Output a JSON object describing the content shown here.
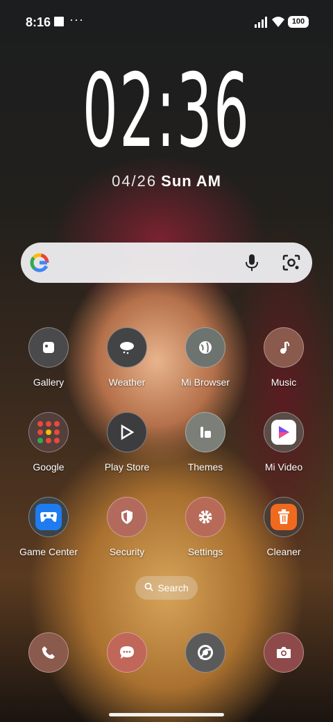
{
  "status_bar": {
    "time": "8:16",
    "more": "···",
    "battery": "100"
  },
  "lock_clock": {
    "time": "02:36",
    "date": "04/26",
    "weekday": "Sun",
    "ampm": "AM"
  },
  "search_widget": {
    "google_label": "G"
  },
  "apps": [
    {
      "label": "Gallery",
      "icon": "gallery-icon"
    },
    {
      "label": "Weather",
      "icon": "weather-icon"
    },
    {
      "label": "Mi Browser",
      "icon": "globe-icon"
    },
    {
      "label": "Music",
      "icon": "music-note-icon"
    },
    {
      "label": "Google",
      "icon": "google-folder-icon"
    },
    {
      "label": "Play Store",
      "icon": "play-store-icon"
    },
    {
      "label": "Themes",
      "icon": "themes-icon"
    },
    {
      "label": "Mi Video",
      "icon": "mi-video-icon"
    },
    {
      "label": "Game Center",
      "icon": "gamepad-icon"
    },
    {
      "label": "Security",
      "icon": "shield-icon"
    },
    {
      "label": "Settings",
      "icon": "gear-icon"
    },
    {
      "label": "Cleaner",
      "icon": "trash-icon"
    }
  ],
  "app_search": {
    "label": "Search"
  },
  "dock": [
    {
      "icon": "phone-icon"
    },
    {
      "icon": "messages-icon"
    },
    {
      "icon": "chrome-icon"
    },
    {
      "icon": "camera-icon"
    }
  ]
}
